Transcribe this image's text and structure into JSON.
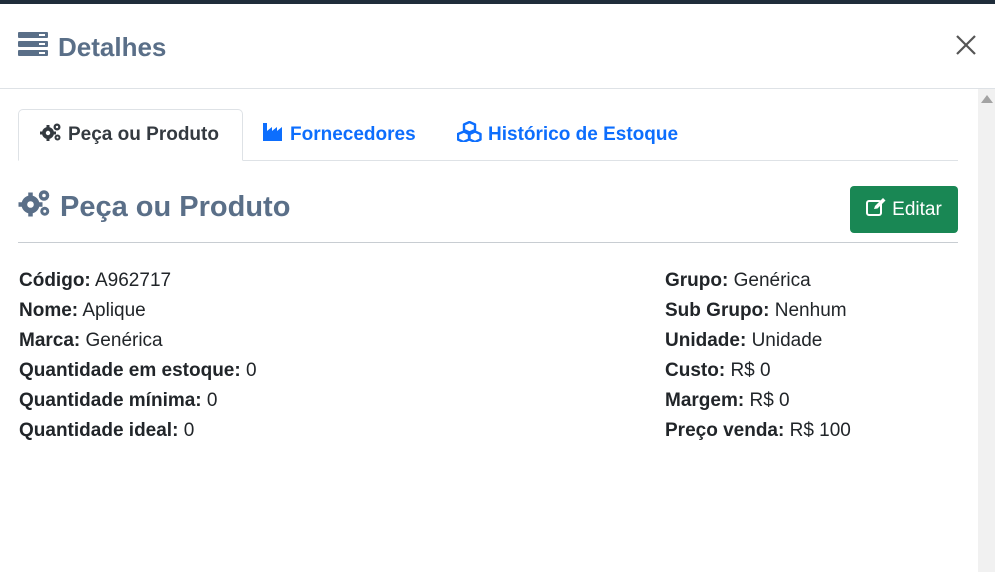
{
  "modal": {
    "title": "Detalhes",
    "icon": "server-icon",
    "close_icon": "close-icon"
  },
  "tabs": [
    {
      "label": "Peça ou Produto",
      "icon": "gears-icon",
      "active": true
    },
    {
      "label": "Fornecedores",
      "icon": "industry-icon",
      "active": false
    },
    {
      "label": "Histórico de Estoque",
      "icon": "cubes-icon",
      "active": false
    }
  ],
  "section": {
    "title": "Peça ou Produto",
    "icon": "gears-icon",
    "edit_label": "Editar",
    "edit_icon": "edit-icon"
  },
  "details_left": [
    {
      "label": "Código:",
      "value": "A962717"
    },
    {
      "label": "Nome:",
      "value": "Aplique"
    },
    {
      "label": "Marca:",
      "value": "Genérica"
    },
    {
      "label": "Quantidade em estoque:",
      "value": "0"
    },
    {
      "label": "Quantidade mínima:",
      "value": "0"
    },
    {
      "label": "Quantidade ideal:",
      "value": "0"
    }
  ],
  "details_right": [
    {
      "label": "Grupo:",
      "value": "Genérica"
    },
    {
      "label": "Sub Grupo:",
      "value": "Nenhum"
    },
    {
      "label": "Unidade:",
      "value": "Unidade"
    },
    {
      "label": "Custo:",
      "value": "R$ 0"
    },
    {
      "label": "Margem:",
      "value": "R$ 0"
    },
    {
      "label": "Preço venda:",
      "value": "R$ 100"
    }
  ],
  "colors": {
    "title": "#5a6f88",
    "link": "#0d6efd",
    "success": "#198754"
  }
}
